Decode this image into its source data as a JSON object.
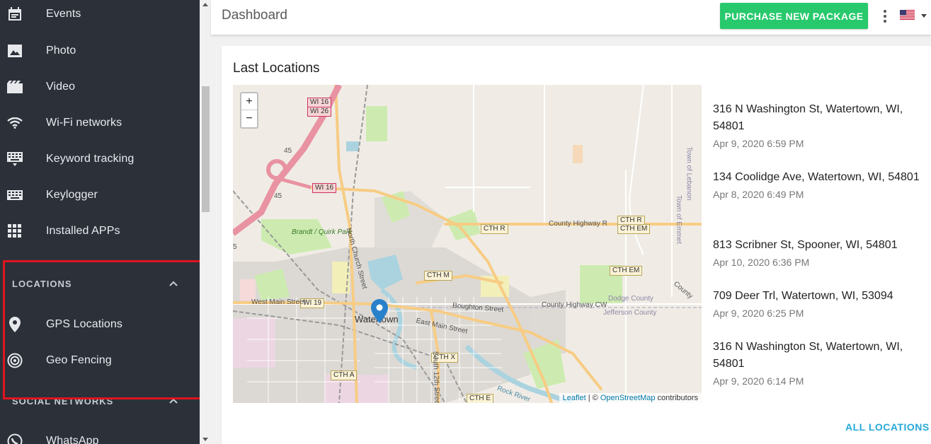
{
  "sidebar": {
    "items": [
      {
        "label": "Events",
        "icon": "calendar-icon"
      },
      {
        "label": "Photo",
        "icon": "image-icon"
      },
      {
        "label": "Video",
        "icon": "film-icon"
      },
      {
        "label": "Wi-Fi networks",
        "icon": "wifi-icon"
      },
      {
        "label": "Keyword tracking",
        "icon": "keyboard-icon"
      },
      {
        "label": "Keylogger",
        "icon": "keyboard-icon"
      },
      {
        "label": "Installed APPs",
        "icon": "apps-grid-icon"
      }
    ],
    "locations_section": {
      "label": "LOCATIONS",
      "items": [
        {
          "label": "GPS Locations",
          "icon": "map-pin-icon"
        },
        {
          "label": "Geo Fencing",
          "icon": "target-icon"
        }
      ]
    },
    "social_section": {
      "label": "SOCIAL NETWORKS",
      "items": [
        {
          "label": "WhatsApp",
          "icon": "whatsapp-icon"
        }
      ]
    },
    "highlight_color": "#e0141e"
  },
  "header": {
    "title": "Dashboard",
    "purchase_label": "PURCHASE NEW PACKAGE",
    "flag": "us-flag-icon"
  },
  "card": {
    "title": "Last Locations",
    "all_locations_label": "ALL LOCATIONS",
    "locations": [
      {
        "address": "316 N Washington St, Watertown, WI, 54801",
        "time": "Apr 9, 2020 6:59 PM"
      },
      {
        "address": "134 Coolidge Ave, Watertown, WI, 54801",
        "time": "Apr 8, 2020 6:49 PM"
      },
      {
        "address": "813 Scribner St, Spooner, WI, 54801",
        "time": "Apr 10, 2020 6:36 PM"
      },
      {
        "address": "709 Deer Trl, Watertown, WI, 53094",
        "time": "Apr 9, 2020 6:25 PM"
      },
      {
        "address": "316 N Washington St, Watertown, WI, 54801",
        "time": "Apr 9, 2020 6:14 PM"
      }
    ]
  },
  "map": {
    "zoom_in": "+",
    "zoom_out": "−",
    "attribution_leaflet": "Leaflet",
    "attribution_sep": " | © ",
    "attribution_osm": "OpenStreetMap",
    "attribution_tail": " contributors",
    "labels": {
      "city": "Watertown",
      "park": "Brandt / Quirk Park",
      "west_main": "West Main Street",
      "east_main": "East Main Street",
      "boughton": "Boughton Street",
      "county_r": "County Highway R",
      "county_cw": "County Highway CW",
      "county_line_1": "Dodge County",
      "county_line_2": "Jefferson County",
      "north_church": "North Church Street",
      "south_12th": "South 12th Street",
      "town_lebanon": "Town of Lebanon",
      "town_emmet": "Town of Emmet",
      "rock_river": "Rock River",
      "county_e": "County",
      "n45a": "45",
      "n45b": "45",
      "n5": "5"
    },
    "shields": {
      "wi16_top": "WI 16",
      "wi26": "WI 26",
      "wi16_mid": "WI 16",
      "wi19": "WI 19",
      "cth_r": "CTH R",
      "cth_r2": "CTH R",
      "cth_em": "CTH EM",
      "cth_em2": "CTH EM",
      "cth_m": "CTH M",
      "cth_x": "CTH X",
      "cth_a": "CTH A",
      "cth_e": "CTH E"
    }
  },
  "colors": {
    "sidebar_bg": "#2b3039",
    "accent_green": "#27c96c",
    "link_blue": "#26a9d8",
    "marker_blue": "#2a81cb"
  }
}
